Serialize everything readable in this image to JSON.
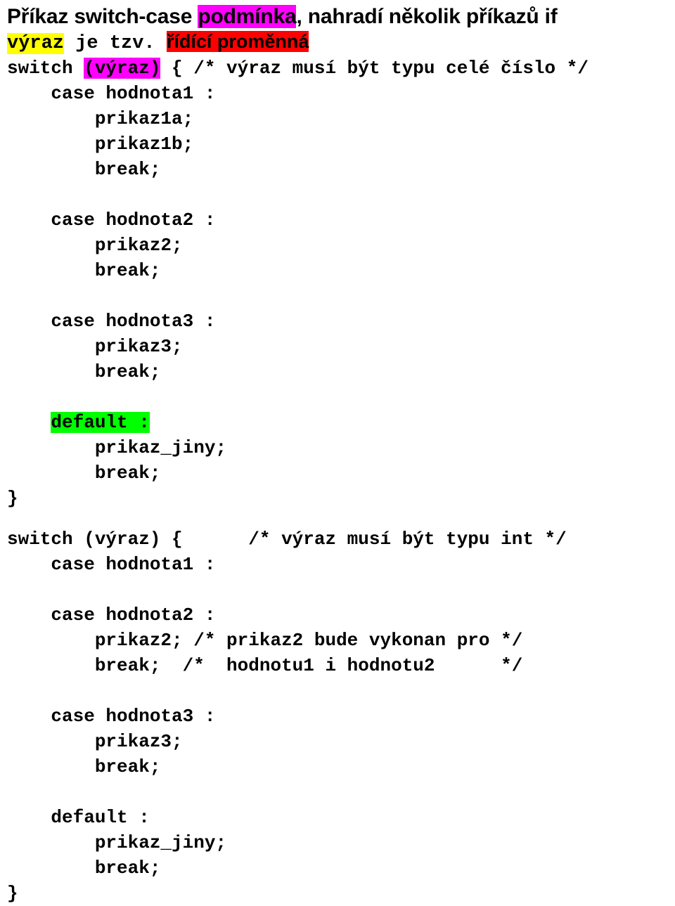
{
  "document": {
    "title_line1_a": "Příkaz switch-case ",
    "title_line1_b": "podmínka",
    "title_line1_c": ", nahradí několik příkazů if",
    "title_line2_a": "výraz",
    "title_line2_b": " je tzv. ",
    "title_line2_c": "řídící proměnná",
    "code_block_1": [
      {
        "id": "l1",
        "segments": [
          {
            "text": "switch ",
            "style": "plain"
          },
          {
            "text": "(výraz)",
            "style": "magenta"
          },
          {
            "text": " { /* výraz musí být typu celé číslo */",
            "style": "plain"
          }
        ]
      },
      {
        "id": "l2",
        "segments": [
          {
            "text": "    case hodnota1 :",
            "style": "plain"
          }
        ]
      },
      {
        "id": "l3",
        "segments": [
          {
            "text": "        prikaz1a;",
            "style": "plain"
          }
        ]
      },
      {
        "id": "l4",
        "segments": [
          {
            "text": "        prikaz1b;",
            "style": "plain"
          }
        ]
      },
      {
        "id": "l5",
        "segments": [
          {
            "text": "        break;",
            "style": "plain"
          }
        ]
      },
      {
        "id": "l6",
        "segments": [
          {
            "text": "",
            "style": "plain"
          }
        ]
      },
      {
        "id": "l7",
        "segments": [
          {
            "text": "    case hodnota2 :",
            "style": "plain"
          }
        ]
      },
      {
        "id": "l8",
        "segments": [
          {
            "text": "        prikaz2;",
            "style": "plain"
          }
        ]
      },
      {
        "id": "l9",
        "segments": [
          {
            "text": "        break;",
            "style": "plain"
          }
        ]
      },
      {
        "id": "l10",
        "segments": [
          {
            "text": "",
            "style": "plain"
          }
        ]
      },
      {
        "id": "l11",
        "segments": [
          {
            "text": "    case hodnota3 :",
            "style": "plain"
          }
        ]
      },
      {
        "id": "l12",
        "segments": [
          {
            "text": "        prikaz3;",
            "style": "plain"
          }
        ]
      },
      {
        "id": "l13",
        "segments": [
          {
            "text": "        break;",
            "style": "plain"
          }
        ]
      },
      {
        "id": "l14",
        "segments": [
          {
            "text": "",
            "style": "plain"
          }
        ]
      },
      {
        "id": "l15",
        "segments": [
          {
            "text": "    ",
            "style": "plain"
          },
          {
            "text": "default :",
            "style": "green"
          }
        ]
      },
      {
        "id": "l16",
        "segments": [
          {
            "text": "        prikaz_jiny;",
            "style": "plain"
          }
        ]
      },
      {
        "id": "l17",
        "segments": [
          {
            "text": "        break;",
            "style": "plain"
          }
        ]
      },
      {
        "id": "l18",
        "segments": [
          {
            "text": "}",
            "style": "plain"
          }
        ]
      }
    ],
    "code_block_2": [
      {
        "id": "m1",
        "segments": [
          {
            "text": "switch (výraz) {      /* výraz musí být typu int */",
            "style": "plain"
          }
        ]
      },
      {
        "id": "m2",
        "segments": [
          {
            "text": "    case hodnota1 :",
            "style": "plain"
          }
        ]
      },
      {
        "id": "m3",
        "segments": [
          {
            "text": "",
            "style": "plain"
          }
        ]
      },
      {
        "id": "m4",
        "segments": [
          {
            "text": "    case hodnota2 :",
            "style": "plain"
          }
        ]
      },
      {
        "id": "m5",
        "segments": [
          {
            "text": "        prikaz2; /* prikaz2 bude vykonan pro */",
            "style": "plain"
          }
        ]
      },
      {
        "id": "m6",
        "segments": [
          {
            "text": "        break;  /*  hodnotu1 i hodnotu2      */",
            "style": "plain"
          }
        ]
      },
      {
        "id": "m7",
        "segments": [
          {
            "text": "",
            "style": "plain"
          }
        ]
      },
      {
        "id": "m8",
        "segments": [
          {
            "text": "    case hodnota3 :",
            "style": "plain"
          }
        ]
      },
      {
        "id": "m9",
        "segments": [
          {
            "text": "        prikaz3;",
            "style": "plain"
          }
        ]
      },
      {
        "id": "m10",
        "segments": [
          {
            "text": "        break;",
            "style": "plain"
          }
        ]
      },
      {
        "id": "m11",
        "segments": [
          {
            "text": "",
            "style": "plain"
          }
        ]
      },
      {
        "id": "m12",
        "segments": [
          {
            "text": "    default :",
            "style": "plain"
          }
        ]
      },
      {
        "id": "m13",
        "segments": [
          {
            "text": "        prikaz_jiny;",
            "style": "plain"
          }
        ]
      },
      {
        "id": "m14",
        "segments": [
          {
            "text": "        break;",
            "style": "plain"
          }
        ]
      },
      {
        "id": "m15",
        "segments": [
          {
            "text": "}",
            "style": "plain"
          }
        ]
      }
    ]
  },
  "colors": {
    "magenta": "#ff00ff",
    "yellow": "#ffff00",
    "red": "#ff0000",
    "cyan": "#00ffff",
    "green": "#00ff00",
    "text": "#000000",
    "background": "#ffffff"
  }
}
